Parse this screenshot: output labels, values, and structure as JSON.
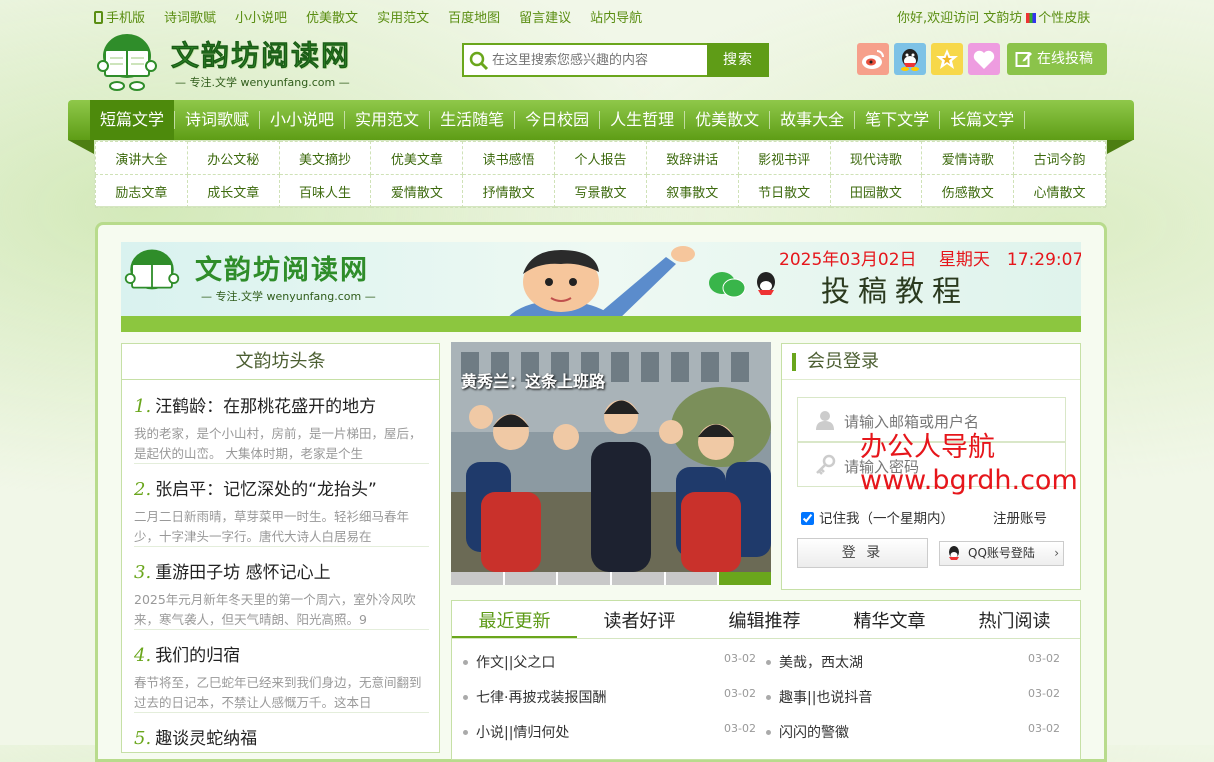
{
  "top_links": [
    "手机版",
    "诗词歌赋",
    "小小说吧",
    "优美散文",
    "实用范文",
    "百度地图",
    "留言建议",
    "站内导航"
  ],
  "welcome": {
    "text": "你好,欢迎访问 文韵坊",
    "skin": "个性皮肤"
  },
  "logo": {
    "title": "文韵坊阅读网",
    "slogan": "— 专注.文学 wenyunfang.com —"
  },
  "search": {
    "placeholder": "在这里搜索您感兴趣的内容",
    "button": "搜索"
  },
  "social_icons": [
    "weibo-icon",
    "qq-icon",
    "star-icon",
    "heart-icon"
  ],
  "tougao": "在线投稿",
  "nav": [
    "短篇文学",
    "诗词歌赋",
    "小小说吧",
    "实用范文",
    "生活随笔",
    "今日校园",
    "人生哲理",
    "优美散文",
    "故事大全",
    "笔下文学",
    "长篇文学"
  ],
  "subnav": [
    [
      "演讲大全",
      "办公文秘",
      "美文摘抄",
      "优美文章",
      "读书感悟",
      "个人报告",
      "致辞讲话",
      "影视书评",
      "现代诗歌",
      "爱情诗歌",
      "古词今韵"
    ],
    [
      "励志文章",
      "成长文章",
      "百味人生",
      "爱情散文",
      "抒情散文",
      "写景散文",
      "叙事散文",
      "节日散文",
      "田园散文",
      "伤感散文",
      "心情散文"
    ]
  ],
  "banner": {
    "logo_title": "文韵坊阅读网",
    "logo_slogan": "— 专注.文学 wenyunfang.com —",
    "date": "2025年03月02日　 星期天　17:29:07",
    "caption": "投稿教程"
  },
  "headlines": {
    "title": "文韵坊头条",
    "items": [
      {
        "num": "1.",
        "title": "汪鹤龄：在那桃花盛开的地方",
        "desc": "我的老家，是个小山村，房前，是一片梯田，屋后，是起伏的山峦。 大集体时期，老家是个生"
      },
      {
        "num": "2.",
        "title": "张启平：记忆深处的“龙抬头”",
        "desc": "二月二日新雨晴，草芽菜甲一时生。轻衫细马春年少，十字津头一字行。唐代大诗人白居易在"
      },
      {
        "num": "3.",
        "title": "重游田子坊 感怀记心上",
        "desc": "2025年元月新年冬天里的第一个周六，室外冷风吹来，寒气袭人，但天气晴朗、阳光高照。9"
      },
      {
        "num": "4.",
        "title": "我们的归宿",
        "desc": "春节将至，乙巳蛇年已经来到我们身边，无意间翻到过去的日记本，不禁让人感慨万千。这本日"
      },
      {
        "num": "5.",
        "title": "趣谈灵蛇纳福",
        "desc": ""
      }
    ]
  },
  "slider": {
    "caption": "黄秀兰：这条上班路",
    "slides": 6,
    "active": 6
  },
  "login": {
    "title": "会员登录",
    "user_placeholder": "请输入邮箱或用户名",
    "pass_placeholder": "请输入密码",
    "remember": "记住我（一个星期内）",
    "register": "注册账号",
    "login_button": "登 录",
    "qq_login": "QQ账号登陆"
  },
  "watermark": {
    "line1": "办公人导航",
    "line2": "www.bgrdh.com"
  },
  "tabs": [
    "最近更新",
    "读者好评",
    "编辑推荐",
    "精华文章",
    "热门阅读"
  ],
  "recent": {
    "left": [
      {
        "title": "作文||父之口",
        "date": "03-02"
      },
      {
        "title": "七律·再披戎装报国酬",
        "date": "03-02"
      },
      {
        "title": "小说||情归何处",
        "date": "03-02"
      }
    ],
    "right": [
      {
        "title": "美哉，西太湖",
        "date": "03-02"
      },
      {
        "title": "趣事||也说抖音",
        "date": "03-02"
      },
      {
        "title": "闪闪的警徽",
        "date": "03-02"
      }
    ]
  },
  "colors": {
    "accent": "#6aa61c",
    "nav_dark": "#4d8a0c",
    "red": "#e6161b"
  }
}
